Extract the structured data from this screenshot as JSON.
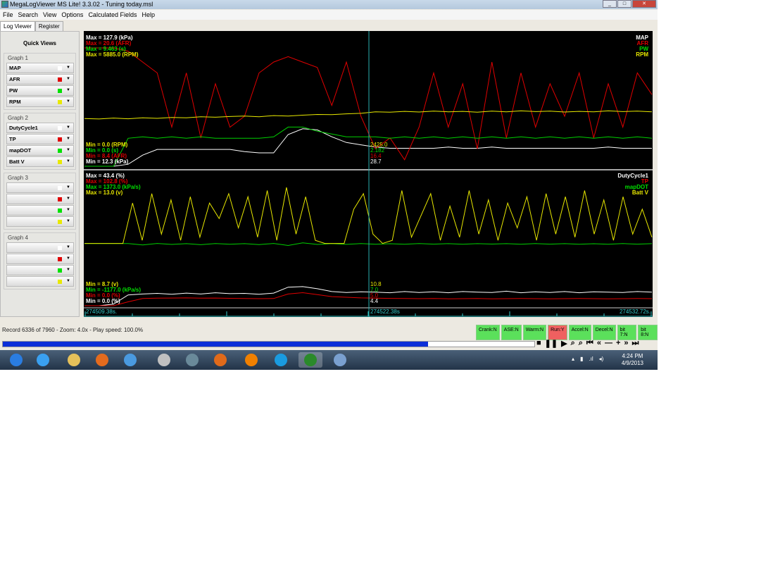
{
  "window": {
    "title": "MegaLogViewer MS Lite! 3.3.02 - Tuning today.msl",
    "minimize": "_",
    "maximize": "□",
    "close": "✕"
  },
  "menu": [
    "File",
    "Search",
    "View",
    "Options",
    "Calculated Fields",
    "Help"
  ],
  "tabs": [
    "Log Viewer",
    "Register"
  ],
  "sidebar": {
    "title": "Quick Views",
    "groups": [
      {
        "label": "Graph 1",
        "items": [
          "MAP",
          "AFR",
          "PW",
          "RPM"
        ]
      },
      {
        "label": "Graph 2",
        "items": [
          "DutyCycle1",
          "TP",
          "mapDOT",
          "Batt V"
        ]
      },
      {
        "label": "Graph 3",
        "items": [
          "",
          "",
          "",
          ""
        ]
      },
      {
        "label": "Graph 4",
        "items": [
          "",
          "",
          "",
          ""
        ]
      }
    ],
    "swatch_colors": [
      "#ffffff",
      "#e00000",
      "#00e000",
      "#e8e800"
    ]
  },
  "graph1": {
    "max_labels": [
      "Max = 127.9 (kPa)",
      "Max = 20.6 (AFR)",
      "Max = 9.463 (s)",
      "Max = 5885.0 (RPM)"
    ],
    "min_labels": [
      "Min = 0.0 (RPM)",
      "Min = 0.0 (s)",
      "Min = 8.4 (AFR)",
      "Min = 12.3 (kPa)"
    ],
    "legend": [
      "MAP",
      "AFR",
      "PW",
      "RPM"
    ],
    "cursor_values": [
      "2425.0",
      "2.182",
      "16.4",
      "28.7"
    ],
    "series": [
      {
        "name": "MAP",
        "color": "#ffffff",
        "min": 12.3,
        "max": 127.9,
        "values": [
          12.3,
          12.3,
          12.3,
          14,
          22,
          27,
          27,
          27,
          27,
          27,
          27,
          25,
          24,
          24,
          40,
          45,
          44,
          38,
          33,
          31,
          29,
          28,
          28,
          28,
          28,
          29,
          28,
          28,
          29,
          28,
          28,
          28,
          28,
          28,
          28,
          28,
          29,
          28,
          28,
          28
        ]
      },
      {
        "name": "AFR",
        "color": "#e00000",
        "min": 8.4,
        "max": 20.6,
        "values": [
          19.3,
          19.3,
          19.3,
          19.0,
          18,
          17,
          12,
          17,
          11,
          16,
          12,
          13,
          17,
          18,
          18.5,
          18,
          17.5,
          14,
          18,
          13,
          10,
          11,
          9,
          12,
          17,
          12,
          16,
          10,
          18,
          11,
          17,
          12,
          16,
          13,
          17,
          11,
          16,
          12,
          17,
          15
        ]
      },
      {
        "name": "PW",
        "color": "#00d000",
        "min": 0,
        "max": 9.463,
        "values": [
          0,
          0,
          0,
          2.0,
          2.1,
          2.0,
          2.1,
          2.0,
          2.1,
          2.0,
          2.0,
          2.0,
          2.0,
          2.1,
          2.8,
          2.8,
          2.5,
          2.3,
          2.1,
          2.1,
          2.1,
          2.0,
          2.1,
          2.0,
          2.1,
          2.0,
          2.1,
          2.0,
          2.1,
          2.0,
          2.1,
          2.0,
          2.1,
          2.0,
          2.1,
          2.0,
          2.1,
          2.0,
          2.1,
          2.0
        ]
      },
      {
        "name": "RPM",
        "color": "#e8e800",
        "min": 0,
        "max": 5885,
        "values": [
          2120,
          2100,
          2140,
          2110,
          2150,
          2130,
          2170,
          2150,
          2200,
          2180,
          2210,
          2230,
          2200,
          2250,
          2230,
          2270,
          2300,
          2290,
          2330,
          2350,
          2420,
          2400,
          2440,
          2410,
          2450,
          2420,
          2440,
          2400,
          2450,
          2420,
          2460,
          2430,
          2450,
          2410,
          2440,
          2420,
          2460,
          2430,
          2450,
          2420
        ]
      }
    ]
  },
  "graph2": {
    "max_labels": [
      "Max = 43.4 (%)",
      "Max = 102.8 (%)",
      "Max = 1373.0 (kPa/s)",
      "Max = 13.0 (v)"
    ],
    "min_labels": [
      "Min = 8.7 (v)",
      "Min = -1177.0 (kPa/s)",
      "Min = 0.0 (%)",
      "Min = 0.0 (%)"
    ],
    "legend": [
      "DutyCycle1",
      "TP",
      "mapDOT",
      "Batt V"
    ],
    "cursor_values": [
      "10.8",
      "7.0",
      "5.0",
      "4.4"
    ],
    "series": [
      {
        "name": "DutyCycle1",
        "color": "#ffffff",
        "min": 0,
        "max": 43.4,
        "values": [
          0,
          0,
          0.5,
          3.5,
          3.8,
          4.0,
          3.7,
          4.1,
          3.8,
          4.2,
          3.9,
          4.0,
          3.7,
          4.1,
          6.0,
          6.2,
          5.5,
          4.6,
          4.3,
          4.5,
          4.4,
          4.2,
          4.6,
          4.3,
          4.5,
          4.2,
          4.6,
          4.4,
          4.3,
          4.7,
          4.2,
          4.5,
          4.3,
          4.6,
          4.2,
          4.5,
          4.4,
          4.3,
          4.6,
          4.4
        ]
      },
      {
        "name": "TP",
        "color": "#e00000",
        "min": 0,
        "max": 102.8,
        "values": [
          0,
          0,
          0,
          3,
          5.5,
          5.8,
          5.9,
          6.0,
          5.8,
          5.9,
          5.7,
          5.5,
          5.4,
          5.5,
          9,
          10,
          8.5,
          7,
          6.5,
          6,
          5.8,
          5.6,
          5.5,
          5.4,
          5.5,
          5.3,
          5.4,
          5.5,
          5.3,
          5.4,
          5.5,
          5.4,
          5.3,
          5.4,
          5.5,
          5.4,
          5.3,
          5.4,
          5.5,
          5.4
        ]
      },
      {
        "name": "mapDOT",
        "color": "#00d000",
        "min": -1177,
        "max": 1373,
        "values": [
          7,
          7,
          7,
          7,
          -20,
          10,
          -10,
          5,
          -15,
          8,
          -5,
          6,
          -12,
          9,
          -30,
          20,
          -10,
          5,
          -8,
          7,
          -5,
          4,
          -6,
          8,
          -4,
          5,
          -7,
          6,
          -3,
          5,
          -6,
          7,
          -4,
          6,
          -5,
          4,
          -6,
          7,
          -4,
          5
        ]
      },
      {
        "name": "Batt V",
        "color": "#e8e800",
        "min": 8.7,
        "max": 13.0,
        "values": [
          10.7,
          10.7,
          10.7,
          10.7,
          10.7,
          12.0,
          10.8,
          12.3,
          11.0,
          12.1,
          10.8,
          12.2,
          10.9,
          12.0,
          11.5,
          12.3,
          11.2,
          12.2,
          10.9,
          12.4,
          10.8,
          12.5,
          11.0,
          12.2,
          10.8,
          10.7,
          10.7,
          10.7,
          11.8,
          12.3,
          11.0,
          10.7,
          10.8,
          12.4,
          10.9,
          11.6,
          12.3,
          10.8,
          11.9,
          10.9,
          12.4,
          11.0,
          12.1,
          10.8,
          12.0,
          11.2,
          12.2,
          10.8,
          12.3,
          11.0,
          12.2,
          10.9,
          12.4,
          11.0,
          12.1,
          10.8,
          12.2,
          11.0,
          11.8,
          10.9
        ]
      }
    ]
  },
  "time_axis": {
    "start": "274509.38s.",
    "cursor": "274522.38s",
    "end": "274532.72s."
  },
  "status": {
    "text": "Record 6336 of 7960 - Zoom: 4.0x - Play speed: 100.0%",
    "progress_percent": 80
  },
  "flags": [
    {
      "label": "Crank:N",
      "on": false
    },
    {
      "label": "ASE:N",
      "on": false
    },
    {
      "label": "Warm:N",
      "on": false
    },
    {
      "label": "Run:Y",
      "on": true
    },
    {
      "label": "Accel:N",
      "on": false
    },
    {
      "label": "Decel:N",
      "on": false
    },
    {
      "label": "bit 7:N",
      "on": false
    },
    {
      "label": "bit 8:N",
      "on": false
    }
  ],
  "controls": [
    "■",
    "❚❚",
    "▶",
    "⌕",
    "⌕",
    "⏮",
    "«",
    "—",
    "+",
    "»",
    "⏭"
  ],
  "taskbar": {
    "time": "4:24 PM",
    "date": "4/9/2013",
    "apps": [
      "start",
      "internet-explorer",
      "file-explorer",
      "media-player",
      "chrome",
      "remote-desktop",
      "hp",
      "firefox",
      "vlc",
      "skype",
      "megalogviewer",
      "paint"
    ],
    "app_colors": [
      "#2a7de1",
      "#3aa0f0",
      "#e6c15a",
      "#e46b1e",
      "#4a9ae0",
      "#c0c0c0",
      "#6a8a9a",
      "#e06a1a",
      "#f08000",
      "#1a9be0",
      "#2a8a2a",
      "#7aa0d0"
    ]
  }
}
